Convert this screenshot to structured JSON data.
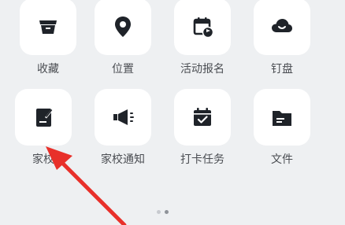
{
  "grid": {
    "row1": [
      {
        "label": "收藏",
        "icon": "archive-box-icon"
      },
      {
        "label": "位置",
        "icon": "location-pin-icon"
      },
      {
        "label": "活动报名",
        "icon": "calendar-flag-icon"
      },
      {
        "label": "钉盘",
        "icon": "cloud-icon"
      }
    ],
    "row2": [
      {
        "label": "家校",
        "icon": "notebook-pen-icon"
      },
      {
        "label": "家校通知",
        "icon": "megaphone-icon"
      },
      {
        "label": "打卡任务",
        "icon": "calendar-check-icon"
      },
      {
        "label": "文件",
        "icon": "folder-icon"
      }
    ]
  },
  "pagination": {
    "total": 2,
    "active": 2
  },
  "colors": {
    "background": "#eef0f2",
    "tile": "#ffffff",
    "icon": "#1f2329",
    "label": "#4a4d52",
    "arrow": "#e8302a"
  }
}
